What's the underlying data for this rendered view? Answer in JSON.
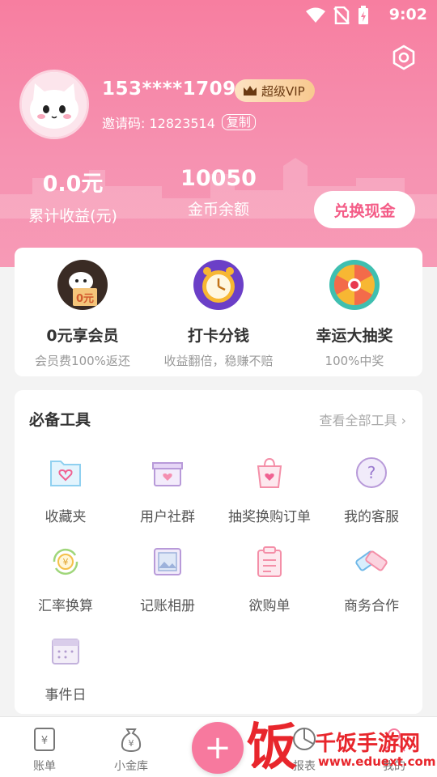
{
  "status_bar": {
    "time": "9:02"
  },
  "profile": {
    "phone": "153****1709",
    "vip_label": "超级VIP",
    "invite_label": "邀请码: 12823514",
    "copy_label": "复制"
  },
  "stats": {
    "earnings_value": "0.0元",
    "earnings_label": "累计收益(元)",
    "coins_value": "10050",
    "coins_label": "金币余额",
    "exchange_label": "兑换现金"
  },
  "features": [
    {
      "title": "0元享会员",
      "subtitle": "会员费100%返还",
      "badge": "0元",
      "icon": "cat-gift-icon"
    },
    {
      "title": "打卡分钱",
      "subtitle": "收益翻倍，稳赚不赔",
      "icon": "alarm-clock-icon"
    },
    {
      "title": "幸运大抽奖",
      "subtitle": "100%中奖",
      "icon": "lucky-wheel-icon"
    }
  ],
  "tools": {
    "title": "必备工具",
    "view_all": "查看全部工具",
    "items": [
      {
        "label": "收藏夹",
        "icon": "folder-heart-icon"
      },
      {
        "label": "用户社群",
        "icon": "gift-box-icon"
      },
      {
        "label": "抽奖换购订单",
        "icon": "shopping-bag-icon"
      },
      {
        "label": "我的客服",
        "icon": "help-icon"
      },
      {
        "label": "汇率换算",
        "icon": "exchange-rate-icon"
      },
      {
        "label": "记账相册",
        "icon": "album-icon"
      },
      {
        "label": "欲购单",
        "icon": "clipboard-icon"
      },
      {
        "label": "商务合作",
        "icon": "handshake-icon"
      },
      {
        "label": "事件日",
        "icon": "calendar-icon"
      }
    ]
  },
  "tabbar": {
    "tabs": [
      {
        "label": "账单",
        "icon": "bill-icon"
      },
      {
        "label": "小金库",
        "icon": "money-bag-icon"
      },
      {
        "label": "报表",
        "icon": "report-icon"
      },
      {
        "label": "我的",
        "icon": "profile-icon"
      }
    ],
    "add_label": "+"
  },
  "watermark": {
    "char": "饭",
    "name": "千饭手游网",
    "url": "www.eduext.com"
  },
  "colors": {
    "brand_pink": "#f77ea0",
    "accent_text": "#f45c87",
    "vip_gold": "#f8c98f",
    "watermark_red": "#e8262c"
  }
}
